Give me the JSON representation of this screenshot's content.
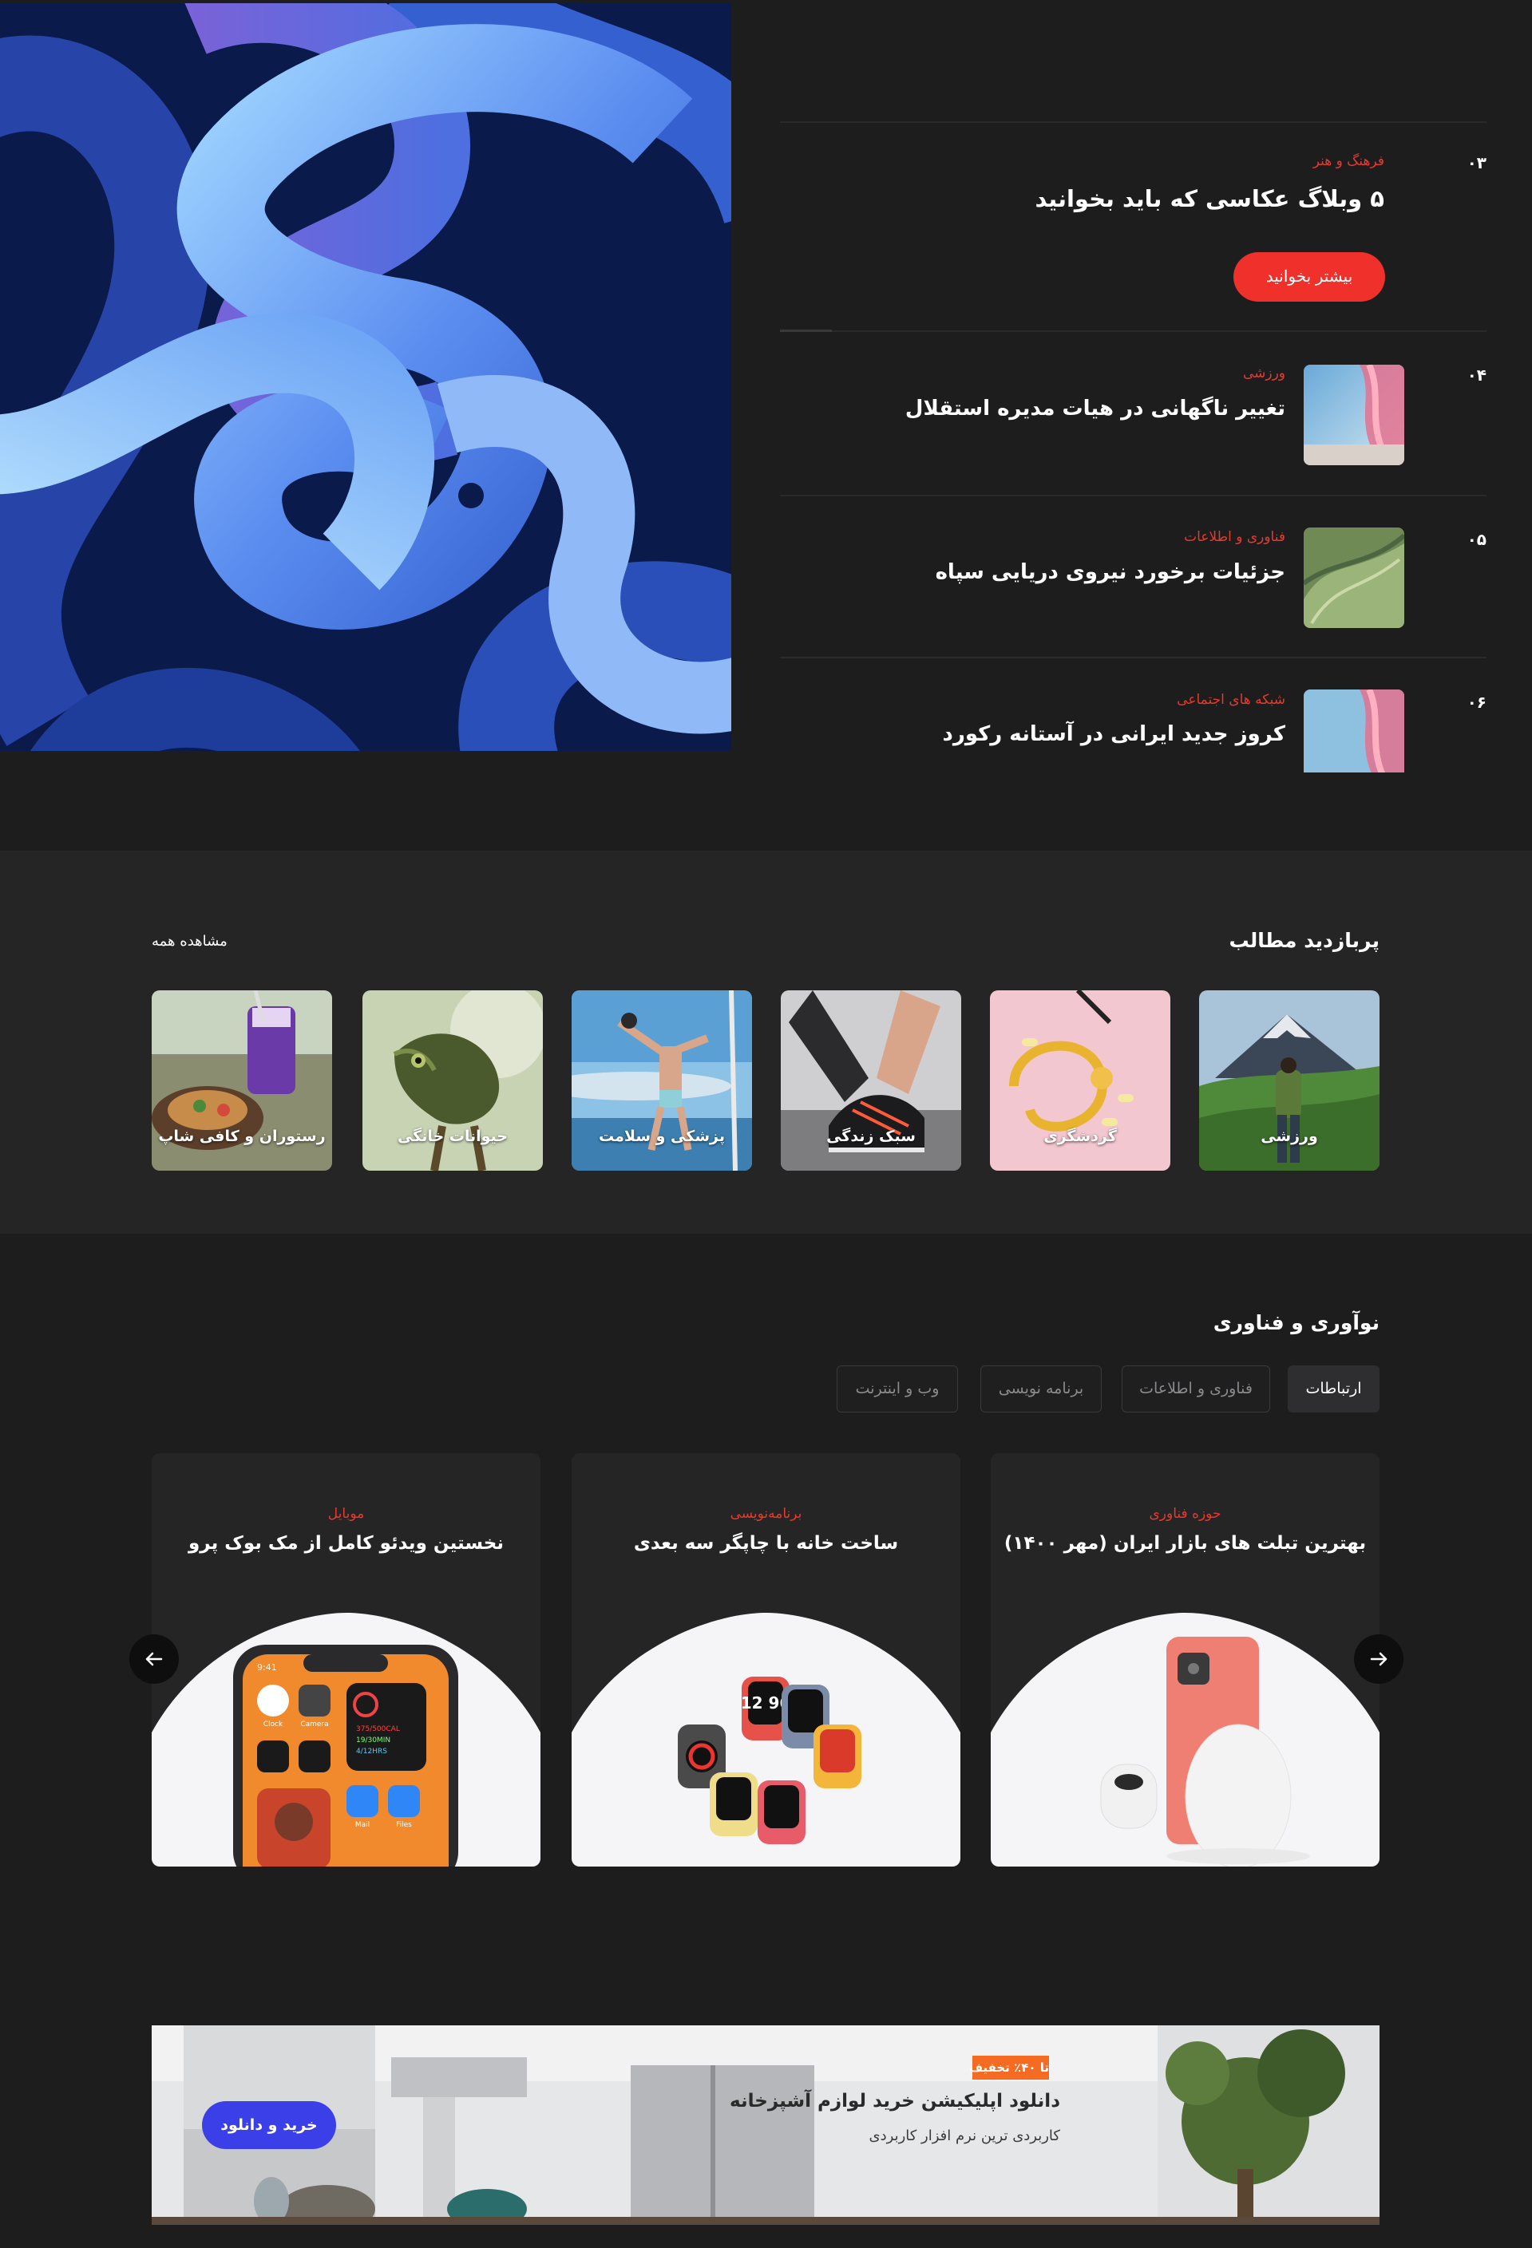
{
  "hero": {
    "items": [
      {
        "number": "۰۳",
        "category": "فرهنگ و هنر",
        "title": "۵ وبلاگ عکاسی که باید بخوانید",
        "button": "بیشتر بخوانید"
      },
      {
        "number": "۰۴",
        "category": "ورزشی",
        "title": "تغییر ناگهانی در هیات مدیره استقلال"
      },
      {
        "number": "۰۵",
        "category": "فناوری و اطلاعات",
        "title": "جزئیات برخورد نیروی دریایی سپاه"
      },
      {
        "number": "۰۶",
        "category": "شبکه های اجتماعی",
        "title": "کروز جدید ایرانی در آستانه رکورد"
      }
    ]
  },
  "popular": {
    "title": "پربازدید مطالب",
    "view_all": "مشاهده همه",
    "categories": [
      {
        "label": "ورزشی"
      },
      {
        "label": "گردشگری"
      },
      {
        "label": "سبک زندگی"
      },
      {
        "label": "پزشکی و سلامت"
      },
      {
        "label": "حیوانات خانگی"
      },
      {
        "label": "رستوران و کافی شاپ"
      }
    ]
  },
  "tech": {
    "title": "نوآوری و فناوری",
    "tabs": [
      {
        "label": "ارتباطات",
        "active": true
      },
      {
        "label": "فناوری و اطلاعات",
        "active": false
      },
      {
        "label": "برنامه نویسی",
        "active": false
      },
      {
        "label": "وب و اینترنت",
        "active": false
      }
    ],
    "posts": [
      {
        "category": "حوزه فناوری",
        "title": "بهترین تبلت های بازار ایران (مهر ۱۴۰۰)"
      },
      {
        "category": "برنامه‌نویسی",
        "title": "ساخت خانه با چاپگر سه بعدی"
      },
      {
        "category": "موبایل",
        "title": "نخستین ویدئو کامل از مک بوک پرو"
      }
    ],
    "phone_screen": {
      "time": "9:41",
      "apps": [
        "Clock",
        "Camera",
        "Mail",
        "Files"
      ],
      "activity": [
        "375/500CAL",
        "19/30MIN",
        "4/12HRS"
      ]
    },
    "watch_face": "12 96"
  },
  "promo": {
    "badge": "تا ۴۰٪ تخفیف",
    "title": "دانلود اپلیکیشن خرید لوازم آشپزخانه",
    "subtitle": "کاربردی ترین نرم افزار کاربردی",
    "button": "خرید و دانلود"
  },
  "colors": {
    "accent_red": "#f0302a",
    "category_red": "#e53a2f",
    "promo_blue": "#3a3fe8",
    "badge_orange": "#f46b21"
  }
}
